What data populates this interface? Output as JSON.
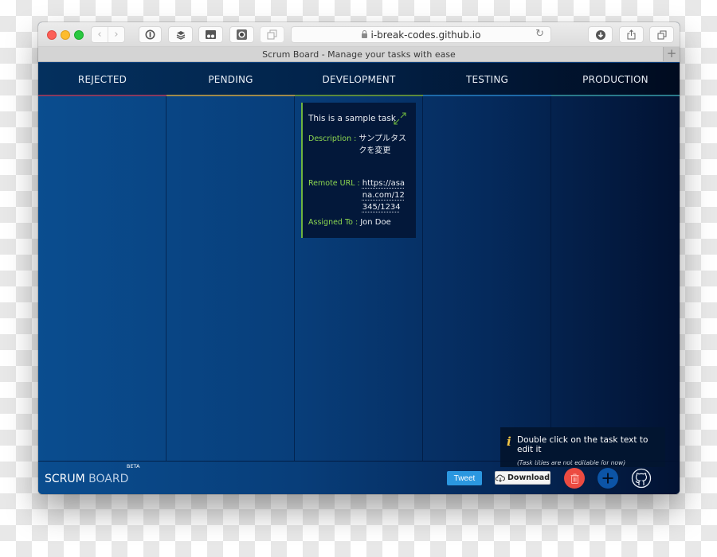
{
  "browser": {
    "url": "i-break-codes.github.io",
    "tab_title": "Scrum Board - Manage your tasks with ease",
    "new_tab_label": "+",
    "toolbar_icons": [
      "back-icon",
      "forward-icon",
      "onepassword-icon",
      "buffer-icon",
      "pocket-icon",
      "screenshot-icon",
      "tabs-icon",
      "download-icon",
      "share-icon",
      "duplicate-tab-icon"
    ]
  },
  "board": {
    "columns": [
      {
        "title": "REJECTED",
        "underline_color": "#8a3a5e"
      },
      {
        "title": "PENDING",
        "underline_color": "#a08a4a"
      },
      {
        "title": "DEVELOPMENT",
        "underline_color": "#5c8a3c"
      },
      {
        "title": "TESTING",
        "underline_color": "#1e6aa8"
      },
      {
        "title": "PRODUCTION",
        "underline_color": "#2a7a8a"
      }
    ],
    "tasks": [
      {
        "column": "DEVELOPMENT",
        "title": "This is a sample task",
        "description_label": "Description :",
        "description": "サンプルタスクを変更",
        "remote_url_label": "Remote URL :",
        "remote_url": "https://asana.com/12345/1234",
        "assigned_label": "Assigned To :",
        "assigned_to": "Jon Doe",
        "accent_color": "#6db33f"
      }
    ]
  },
  "hint": {
    "icon": "info-icon",
    "text": "Double click on the task text to edit it",
    "subtext": "(Task titles are not editable for now)"
  },
  "footer": {
    "brand_primary": "SCRUM",
    "brand_secondary": "BOARD",
    "badge": "BETA",
    "tweet_label": "Tweet",
    "download_label": "Download",
    "colors": {
      "tweet": "#2b97e0",
      "trash": "#ec4b41",
      "add": "#0c54a6"
    }
  }
}
